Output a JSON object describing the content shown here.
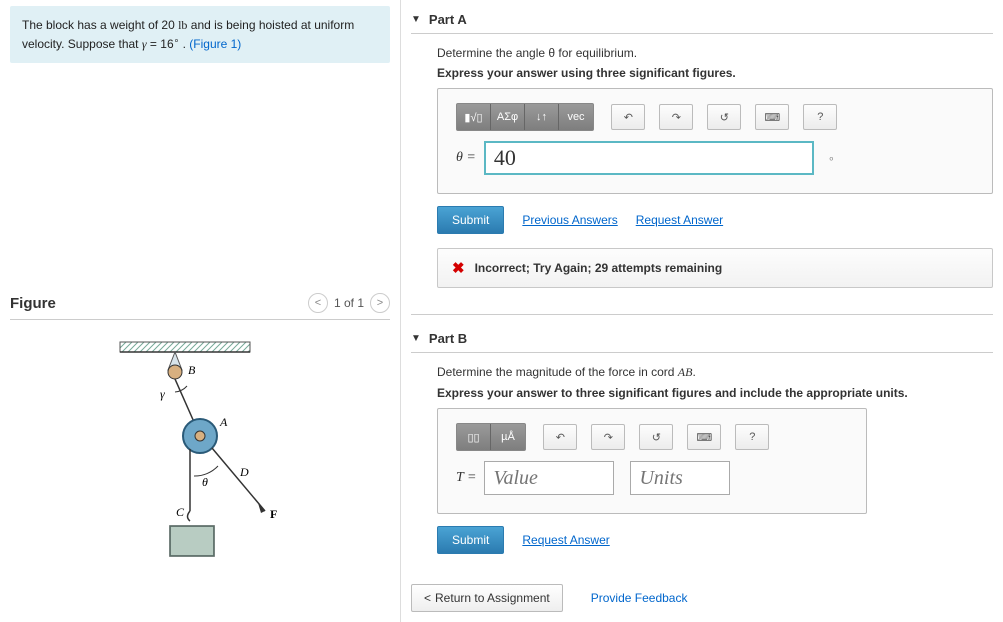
{
  "prompt": {
    "text_before": "The block has a weight of 20 ",
    "unit": "lb",
    "text_mid": " and is being hoisted at uniform velocity. Suppose that ",
    "gamma": "γ",
    "eq": " = 16",
    "text_after": " . ",
    "figlink": "(Figure 1)"
  },
  "figure": {
    "title": "Figure",
    "pager": "1 of 1",
    "labels": {
      "B": "B",
      "A": "A",
      "D": "D",
      "C": "C",
      "F": "F",
      "gamma": "γ",
      "theta": "θ"
    }
  },
  "partA": {
    "title": "Part A",
    "q": "Determine the angle θ for equilibrium.",
    "instr": "Express your answer using three significant figures.",
    "var": "θ =",
    "value": "40",
    "deg": "∘",
    "submit": "Submit",
    "prev": "Previous Answers",
    "req": "Request Answer",
    "feedback": "Incorrect; Try Again; 29 attempts remaining",
    "tools": {
      "t1": "▮√▯",
      "t2": "ΑΣφ",
      "t3": "↓↑",
      "t4": "vec",
      "undo": "↶",
      "redo": "↷",
      "reset": "↺",
      "kb": "⌨",
      "help": "?"
    }
  },
  "partB": {
    "title": "Part B",
    "q_before": "Determine the magnitude of the force in cord ",
    "q_var": "AB",
    "q_after": ".",
    "instr": "Express your answer to three significant figures and include the appropriate units.",
    "var": "T =",
    "value_ph": "Value",
    "units_ph": "Units",
    "submit": "Submit",
    "req": "Request Answer",
    "tools": {
      "t1": "▯▯",
      "t2": "µÅ",
      "undo": "↶",
      "redo": "↷",
      "reset": "↺",
      "kb": "⌨",
      "help": "?"
    }
  },
  "footer": {
    "return": "Return to Assignment",
    "feedback": "Provide Feedback"
  }
}
